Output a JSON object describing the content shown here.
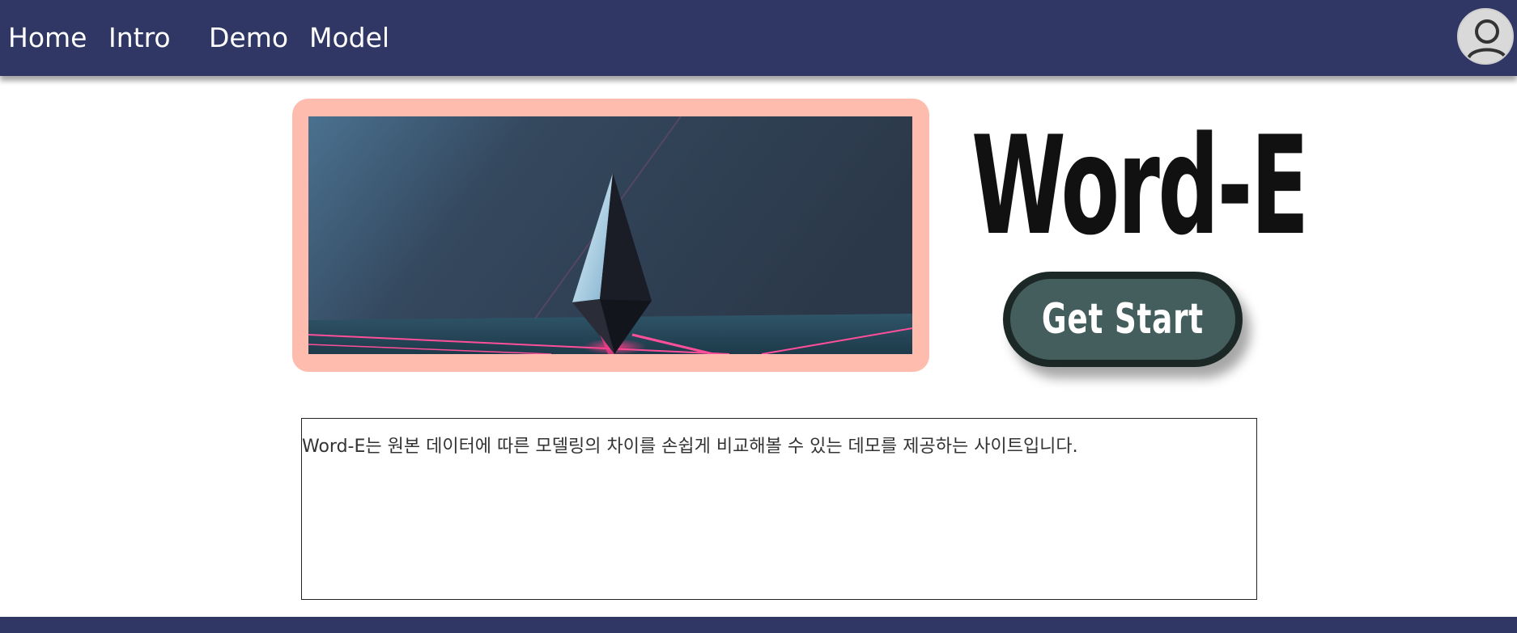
{
  "nav": {
    "items": [
      {
        "label": "Home"
      },
      {
        "label": "Intro"
      },
      {
        "label": "Demo"
      },
      {
        "label": "Model"
      }
    ]
  },
  "hero": {
    "logo_text": "Word-E",
    "start_label": "Get Start"
  },
  "description": {
    "text": "Word-E는 원본 데이터에 따른 모델링의 차이를 손쉽게 비교해볼 수 있는 데모를 제공하는 사이트입니다."
  },
  "colors": {
    "nav_bg": "#303764",
    "frame": "#fdbcad",
    "button_bg": "#445d5d",
    "button_border": "#1c2826"
  },
  "icons": {
    "profile": "user-avatar-icon"
  }
}
